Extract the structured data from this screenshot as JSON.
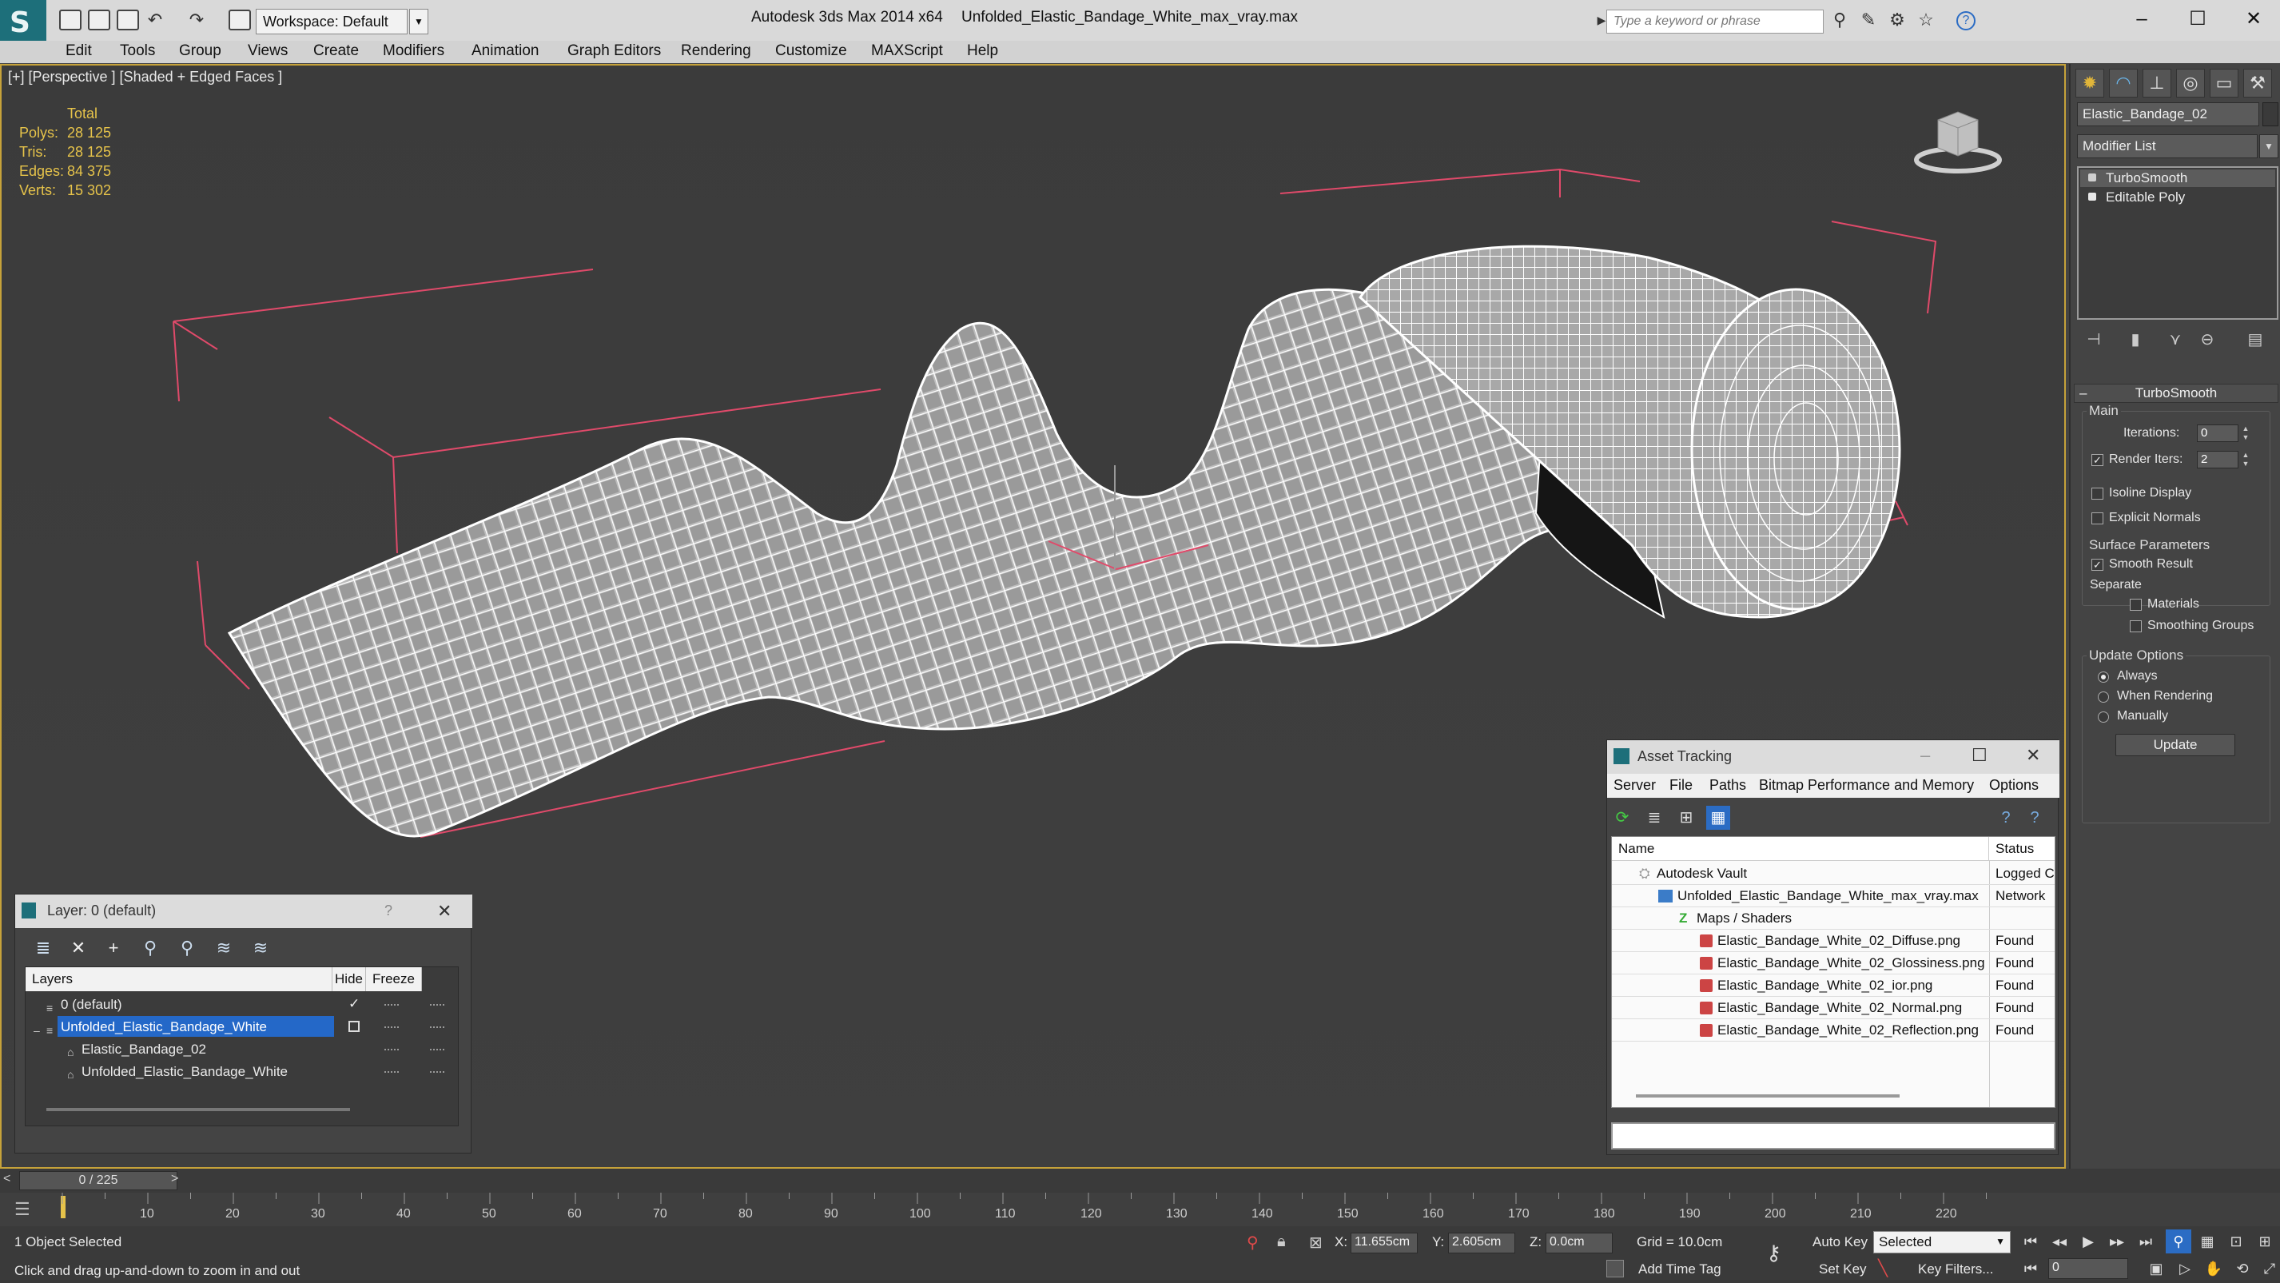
{
  "titlebar": {
    "workspace": "Workspace: Default",
    "app_title": "Autodesk 3ds Max  2014 x64",
    "file_title": "Unfolded_Elastic_Bandage_White_max_vray.max",
    "search_placeholder": "Type a keyword or phrase"
  },
  "menu": [
    "Edit",
    "Tools",
    "Group",
    "Views",
    "Create",
    "Modifiers",
    "Animation",
    "Graph Editors",
    "Rendering",
    "Customize",
    "MAXScript",
    "Help"
  ],
  "viewport": {
    "label": "[+] [Perspective ] [Shaded + Edged Faces ]",
    "stats_header": "Total",
    "stats": [
      {
        "label": "Polys:",
        "value": "28 125"
      },
      {
        "label": "Tris:",
        "value": "28 125"
      },
      {
        "label": "Edges:",
        "value": "84 375"
      },
      {
        "label": "Verts:",
        "value": "15 302"
      }
    ]
  },
  "command_panel": {
    "object_name": "Elastic_Bandage_02",
    "modifier_list": "Modifier List",
    "stack": [
      "TurboSmooth",
      "Editable Poly"
    ],
    "rollout_title": "TurboSmooth",
    "main_group": "Main",
    "iterations_label": "Iterations:",
    "iterations_value": "0",
    "render_iters_label": "Render Iters:",
    "render_iters_value": "2",
    "isoline_label": "Isoline Display",
    "explicit_normals_label": "Explicit Normals",
    "surface_group": "Surface Parameters",
    "smooth_result_label": "Smooth Result",
    "separate_label": "Separate",
    "materials_label": "Materials",
    "smoothing_groups_label": "Smoothing Groups",
    "update_group": "Update Options",
    "always_label": "Always",
    "when_rendering_label": "When Rendering",
    "manually_label": "Manually",
    "update_button": "Update"
  },
  "layer_window": {
    "title": "Layer: 0 (default)",
    "help": "?",
    "col_layers": "Layers",
    "col_hide": "Hide",
    "col_freeze": "Freeze",
    "rows": [
      {
        "name": "0 (default)",
        "indent": 0
      },
      {
        "name": "Unfolded_Elastic_Bandage_White",
        "indent": 0
      },
      {
        "name": "Elastic_Bandage_02",
        "indent": 1
      },
      {
        "name": "Unfolded_Elastic_Bandage_White",
        "indent": 1
      }
    ]
  },
  "asset_window": {
    "title": "Asset Tracking",
    "menu": [
      "Server",
      "File",
      "Paths",
      "Bitmap Performance and Memory",
      "Options"
    ],
    "col_name": "Name",
    "col_status": "Status",
    "rows": [
      {
        "name": "Autodesk Vault",
        "status": "Logged C",
        "indent": 0
      },
      {
        "name": "Unfolded_Elastic_Bandage_White_max_vray.max",
        "status": "Network",
        "indent": 1
      },
      {
        "name": "Maps / Shaders",
        "status": "",
        "indent": 2
      },
      {
        "name": "Elastic_Bandage_White_02_Diffuse.png",
        "status": "Found",
        "indent": 3
      },
      {
        "name": "Elastic_Bandage_White_02_Glossiness.png",
        "status": "Found",
        "indent": 3
      },
      {
        "name": "Elastic_Bandage_White_02_ior.png",
        "status": "Found",
        "indent": 3
      },
      {
        "name": "Elastic_Bandage_White_02_Normal.png",
        "status": "Found",
        "indent": 3
      },
      {
        "name": "Elastic_Bandage_White_02_Reflection.png",
        "status": "Found",
        "indent": 3
      }
    ]
  },
  "timeline": {
    "frame": "0 / 225",
    "ticks": [
      "10",
      "20",
      "30",
      "40",
      "50",
      "60",
      "70",
      "80",
      "90",
      "100",
      "110",
      "120",
      "130",
      "140",
      "150",
      "160",
      "170",
      "180",
      "190",
      "200",
      "210",
      "220"
    ]
  },
  "status": {
    "selection": "1 Object Selected",
    "prompt": "Click and drag up-and-down to zoom in and out",
    "x_label": "X:",
    "x_value": "11.655cm",
    "y_label": "Y:",
    "y_value": "2.605cm",
    "z_label": "Z:",
    "z_value": "0.0cm",
    "grid": "Grid = 10.0cm",
    "add_time_tag": "Add Time Tag",
    "auto_key": "Auto Key",
    "set_key": "Set Key",
    "selected": "Selected",
    "key_filters": "Key Filters...",
    "frame_field": "0"
  }
}
